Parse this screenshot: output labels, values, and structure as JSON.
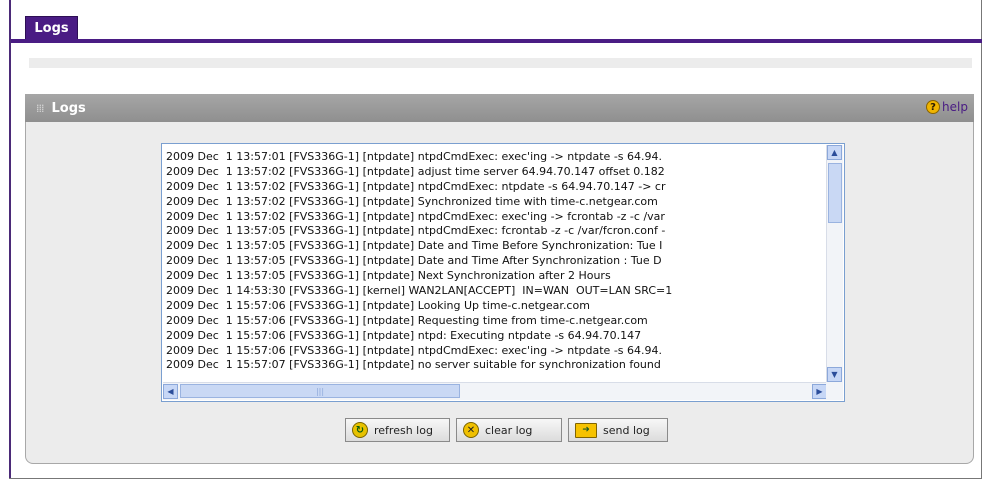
{
  "tab": {
    "label": "Logs"
  },
  "panel": {
    "title": "Logs",
    "help_label": "help"
  },
  "log": {
    "lines": [
      "2009 Dec  1 13:57:01 [FVS336G-1] [ntpdate] ntpdCmdExec: exec'ing -> ntpdate -s 64.94.",
      "2009 Dec  1 13:57:02 [FVS336G-1] [ntpdate] adjust time server 64.94.70.147 offset 0.182",
      "2009 Dec  1 13:57:02 [FVS336G-1] [ntpdate] ntpdCmdExec: ntpdate -s 64.94.70.147 -> cr",
      "2009 Dec  1 13:57:02 [FVS336G-1] [ntpdate] Synchronized time with time-c.netgear.com",
      "2009 Dec  1 13:57:02 [FVS336G-1] [ntpdate] ntpdCmdExec: exec'ing -> fcrontab -z -c /var",
      "2009 Dec  1 13:57:05 [FVS336G-1] [ntpdate] ntpdCmdExec: fcrontab -z -c /var/fcron.conf -",
      "2009 Dec  1 13:57:05 [FVS336G-1] [ntpdate] Date and Time Before Synchronization: Tue I",
      "2009 Dec  1 13:57:05 [FVS336G-1] [ntpdate] Date and Time After Synchronization : Tue D",
      "2009 Dec  1 13:57:05 [FVS336G-1] [ntpdate] Next Synchronization after 2 Hours",
      "2009 Dec  1 14:53:30 [FVS336G-1] [kernel] WAN2LAN[ACCEPT]  IN=WAN  OUT=LAN SRC=1",
      "2009 Dec  1 15:57:06 [FVS336G-1] [ntpdate] Looking Up time-c.netgear.com",
      "2009 Dec  1 15:57:06 [FVS336G-1] [ntpdate] Requesting time from time-c.netgear.com",
      "2009 Dec  1 15:57:06 [FVS336G-1] [ntpdate] ntpd: Executing ntpdate -s 64.94.70.147",
      "2009 Dec  1 15:57:06 [FVS336G-1] [ntpdate] ntpdCmdExec: exec'ing -> ntpdate -s 64.94.",
      "2009 Dec  1 15:57:07 [FVS336G-1] [ntpdate] no server suitable for synchronization found"
    ]
  },
  "buttons": {
    "refresh": "refresh log",
    "clear": "clear log",
    "send": "send log"
  }
}
